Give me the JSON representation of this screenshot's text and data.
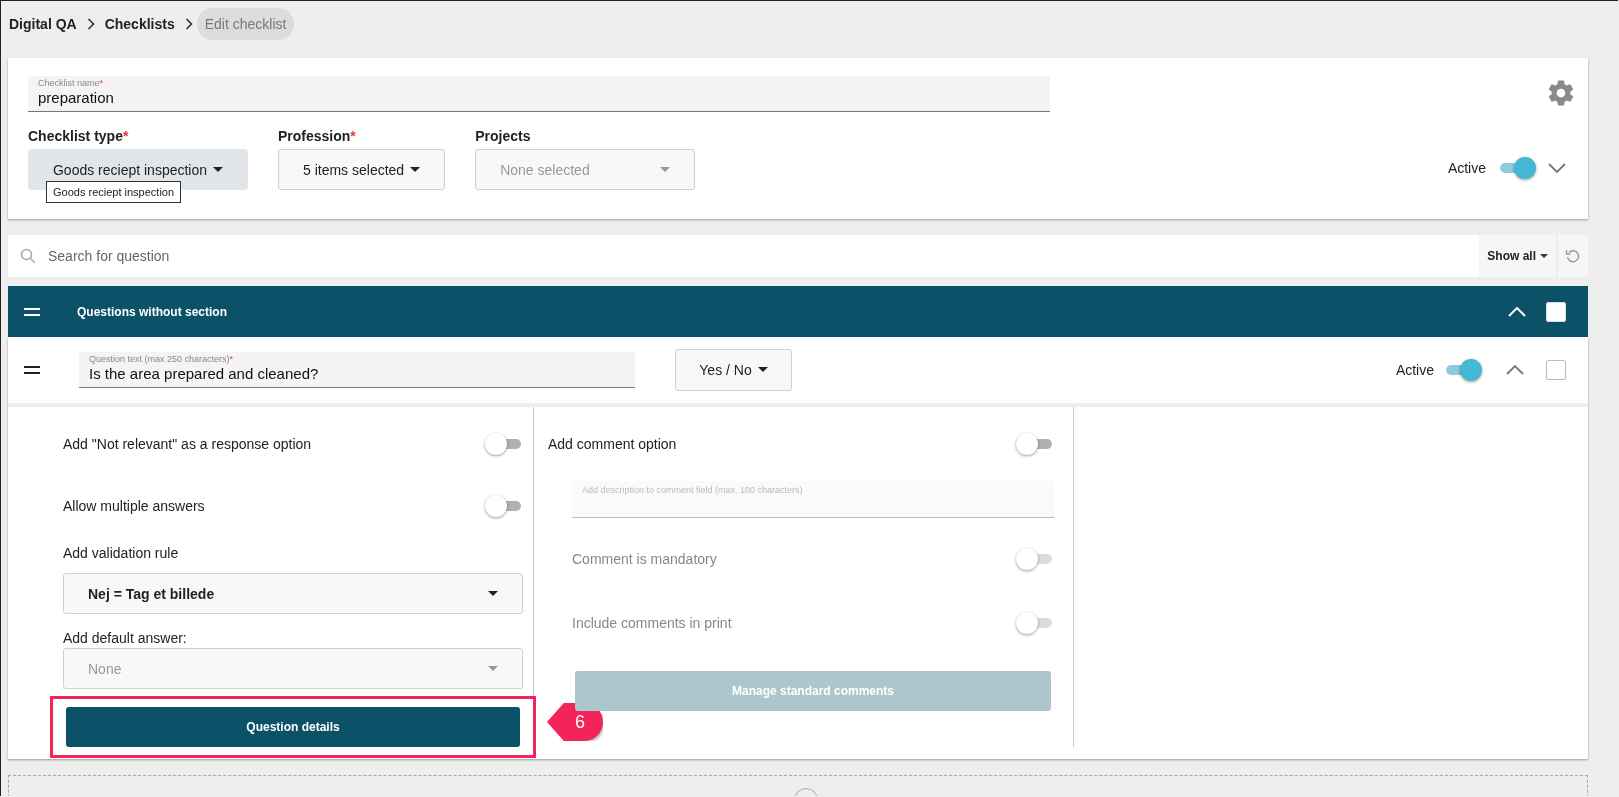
{
  "breadcrumb": [
    {
      "label": "Digital QA",
      "current": false
    },
    {
      "label": "Checklists",
      "current": false
    },
    {
      "label": "Edit checklist",
      "current": true
    }
  ],
  "checklist_name": {
    "label": "Checklist name",
    "required_mark": "*",
    "value": "preparation"
  },
  "filters": [
    {
      "label": "Checklist type",
      "required_mark": "*",
      "value": "Goods reciept inspection",
      "disabled": false,
      "focused": true
    },
    {
      "label": "Profession",
      "required_mark": "*",
      "value": "5 items selected",
      "disabled": false,
      "focused": false
    },
    {
      "label": "Projects",
      "value": "None selected",
      "disabled": true,
      "focused": false
    }
  ],
  "tooltip": "Goods reciept inspection",
  "checklist_active": {
    "label": "Active",
    "on": true
  },
  "search": {
    "placeholder": "Search for question"
  },
  "show_all": "Show all",
  "section": {
    "title": "Questions without section",
    "expanded": true,
    "checked": false
  },
  "question": {
    "field_label": "Question text (max 250 characters)",
    "required_mark": "*",
    "value": "Is the area prepared and cleaned?",
    "answer_type": "Yes / No",
    "active_label": "Active",
    "active": true,
    "expanded": true,
    "checked": false
  },
  "left_options": [
    {
      "kind": "toggle",
      "label": "Add \"Not relevant\" as a response option",
      "on": false,
      "disabled": false
    },
    {
      "kind": "toggle",
      "label": "Allow multiple answers",
      "on": false,
      "disabled": false
    },
    {
      "kind": "select",
      "label": "Add validation rule",
      "value": "Nej = Tag et billede",
      "disabled": false
    },
    {
      "kind": "select",
      "label": "Add default answer:",
      "value": "None",
      "disabled": true
    },
    {
      "kind": "button",
      "label": "Question details",
      "disabled": false,
      "highlighted": true
    }
  ],
  "right_options": [
    {
      "kind": "toggle",
      "label": "Add comment option",
      "on": false,
      "disabled": false
    },
    {
      "kind": "textarea",
      "placeholder": "Add description to comment field (max. 100 characters)"
    },
    {
      "kind": "toggle",
      "label": "Comment is mandatory",
      "on": false,
      "disabled": true
    },
    {
      "kind": "toggle",
      "label": "Include comments in print",
      "on": false,
      "disabled": true
    },
    {
      "kind": "button",
      "label": "Manage standard comments",
      "disabled": true,
      "highlighted": false
    }
  ],
  "callout": {
    "number": "6"
  }
}
